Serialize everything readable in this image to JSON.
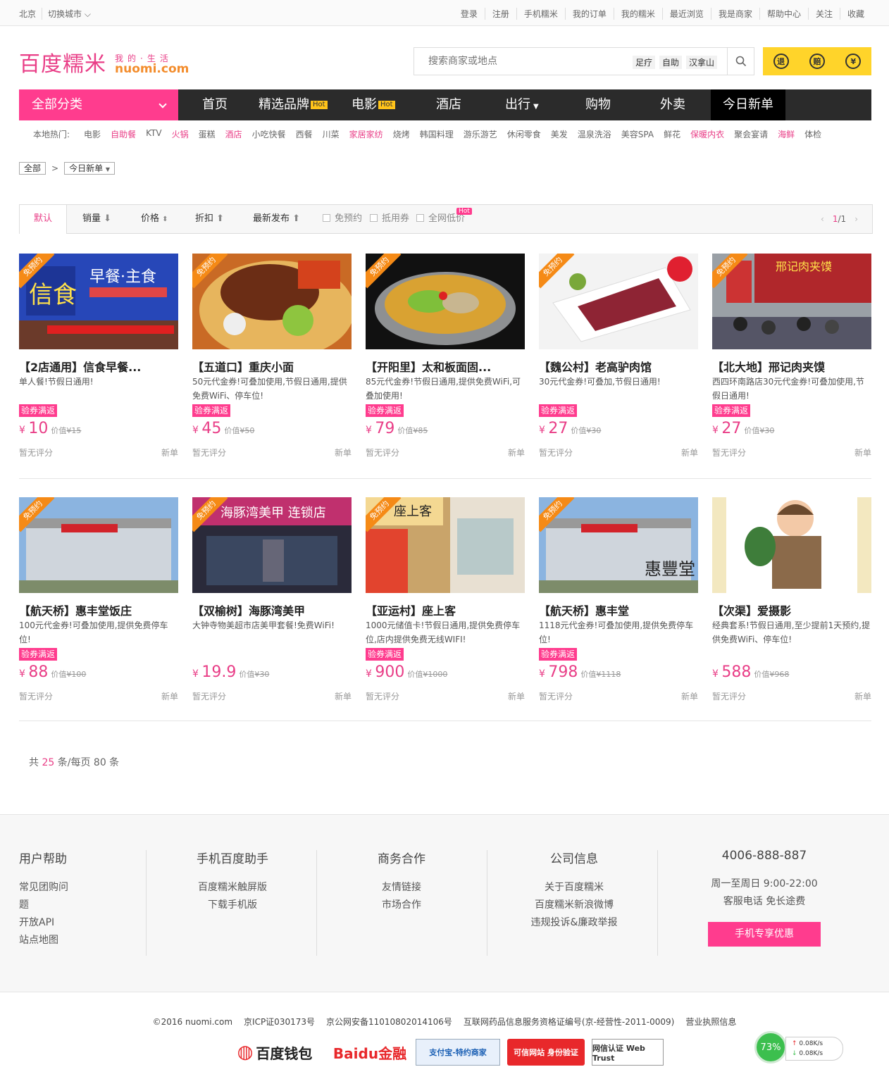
{
  "topbar": {
    "city": "北京",
    "switch_city": "切换城市",
    "links": [
      "登录",
      "注册",
      "手机糯米",
      "我的订单",
      "我的糯米",
      "最近浏览",
      "我是商家",
      "帮助中心",
      "关注",
      "收藏"
    ]
  },
  "logo": {
    "main": "百度糯米",
    "sub": "我的·生活",
    "domain": "nuomi.com"
  },
  "search": {
    "placeholder": "搜索商家或地点",
    "keywords": [
      "足疗",
      "自助",
      "汉拿山"
    ]
  },
  "badges": [
    "退",
    "赔",
    "¥"
  ],
  "nav": {
    "all": "全部分类",
    "items": [
      {
        "label": "首页",
        "hot": ""
      },
      {
        "label": "精选品牌",
        "hot": "Hot"
      },
      {
        "label": "电影",
        "hot": "Hot"
      },
      {
        "label": "酒店",
        "hot": ""
      },
      {
        "label": "出行",
        "hot": ""
      },
      {
        "label": "购物",
        "hot": ""
      },
      {
        "label": "外卖",
        "hot": ""
      }
    ],
    "today": "今日新单"
  },
  "hot": {
    "label": "本地热门:",
    "items": [
      "电影",
      "自助餐",
      "KTV",
      "火锅",
      "蛋糕",
      "酒店",
      "小吃快餐",
      "西餐",
      "川菜",
      "家居家纺",
      "烧烤",
      "韩国料理",
      "游乐游艺",
      "休闲零食",
      "美发",
      "温泉洗浴",
      "美容SPA",
      "鲜花",
      "保暖内衣",
      "聚会宴请",
      "海鲜",
      "体检"
    ],
    "highlight": [
      1,
      3,
      5,
      9,
      18,
      20
    ]
  },
  "crumb": {
    "all": "全部",
    "current": "今日新单"
  },
  "sort": {
    "default": "默认",
    "sales": "销量",
    "price": "价格",
    "discount": "折扣",
    "newest": "最新发布",
    "filters": [
      "免预约",
      "抵用券",
      "全网低价"
    ],
    "filter_hot": "Hot",
    "page": "1",
    "pages": "/1"
  },
  "cards": [
    {
      "title": "【2店通用】信食早餐...",
      "desc": "单人餐!节假日通用!",
      "badge": "验券满返",
      "price": "10",
      "orig": "¥15",
      "tag": "免预约",
      "score": "暂无评分",
      "new": "新单",
      "img": "breakfast"
    },
    {
      "title": "【五道口】重庆小面",
      "desc": "50元代金券!可叠加使用,节假日通用,提供免费WiFi、停车位!",
      "badge": "验券满返",
      "price": "45",
      "orig": "¥50",
      "tag": "免预约",
      "score": "暂无评分",
      "new": "新单",
      "img": "noodle"
    },
    {
      "title": "【开阳里】太和板面固...",
      "desc": "85元代金券!节假日通用,提供免费WiFi,可叠加使用!",
      "badge": "验券满返",
      "price": "79",
      "orig": "¥85",
      "tag": "免预约",
      "score": "暂无评分",
      "new": "新单",
      "img": "hotpot"
    },
    {
      "title": "【魏公村】老高驴肉馆",
      "desc": "30元代金券!可叠加,节假日通用!",
      "badge": "验券满返",
      "price": "27",
      "orig": "¥30",
      "tag": "免预约",
      "score": "暂无评分",
      "new": "新单",
      "img": "meat"
    },
    {
      "title": "【北大地】邢记肉夹馍",
      "desc": "西四环南路店30元代金券!可叠加使用,节假日通用!",
      "badge": "验券满返",
      "price": "27",
      "orig": "¥30",
      "tag": "免预约",
      "score": "暂无评分",
      "new": "新单",
      "img": "street"
    },
    {
      "title": "【航天桥】惠丰堂饭庄",
      "desc": "100元代金券!可叠加使用,提供免费停车位!",
      "badge": "验券满返",
      "price": "88",
      "orig": "¥100",
      "tag": "免预约",
      "score": "暂无评分",
      "new": "新单",
      "img": "building"
    },
    {
      "title": "【双榆树】海豚湾美甲",
      "desc": "大钟寺物美超市店美甲套餐!免费WiFi!",
      "badge": "",
      "price": "19.9",
      "orig": "¥30",
      "tag": "免预约",
      "score": "暂无评分",
      "new": "新单",
      "img": "nail"
    },
    {
      "title": "【亚运村】座上客",
      "desc": "1000元储值卡!节假日通用,提供免费停车位,店内提供免费无线WIFI!",
      "badge": "验券满返",
      "price": "900",
      "orig": "¥1000",
      "tag": "免预约",
      "score": "暂无评分",
      "new": "新单",
      "img": "shop"
    },
    {
      "title": "【航天桥】惠丰堂",
      "desc": "1118元代金券!可叠加使用,提供免费停车位!",
      "badge": "验券满返",
      "price": "798",
      "orig": "¥1118",
      "tag": "免预约",
      "score": "暂无评分",
      "new": "新单",
      "img": "building2"
    },
    {
      "title": "【次渠】爱摄影",
      "desc": "经典套系!节假日通用,至少提前1天预约,提供免费WiFi、停车位!",
      "badge": "",
      "price": "588",
      "orig": "¥968",
      "tag": "",
      "score": "暂无评分",
      "new": "新单",
      "img": "baby"
    }
  ],
  "count": {
    "pre": "共 ",
    "total": "25",
    "mid": " 条/每页 ",
    "per": "80",
    "post": " 条"
  },
  "footer": {
    "cols": [
      {
        "title": "用户帮助",
        "links": [
          "常见团购问题",
          "开放API",
          "站点地图"
        ]
      },
      {
        "title": "手机百度助手",
        "links": [
          "百度糯米触屏版",
          "下载手机版"
        ]
      },
      {
        "title": "商务合作",
        "links": [
          "友情链接",
          "市场合作"
        ]
      },
      {
        "title": "公司信息",
        "links": [
          "关于百度糯米",
          "百度糯米新浪微博",
          "违规投诉&廉政举报"
        ]
      },
      {
        "title": "4006-888-887",
        "links": [
          "周一至周日 9:00-22:00",
          "客服电话 免长途费"
        ]
      }
    ],
    "promo": "手机专享优惠"
  },
  "legal": [
    "©2016 nuomi.com",
    "京ICP证030173号",
    "京公网安备11010802014106号",
    "互联网药品信息服务资格证编号(京-经营性-2011-0009)",
    "营业执照信息"
  ],
  "trust": [
    "百度钱包",
    "Baidu金融",
    "支付宝-特约商家",
    "可信网站 身份验证",
    "网信认证 Web Trust"
  ],
  "speed": {
    "pct": "73%",
    "up": "0.08K/s",
    "down": "0.08K/s"
  },
  "colors": {
    "accent": "#ff3c8e",
    "nav": "#2b2b2b",
    "yellow": "#ffd42a",
    "orange": "#f58a16"
  }
}
